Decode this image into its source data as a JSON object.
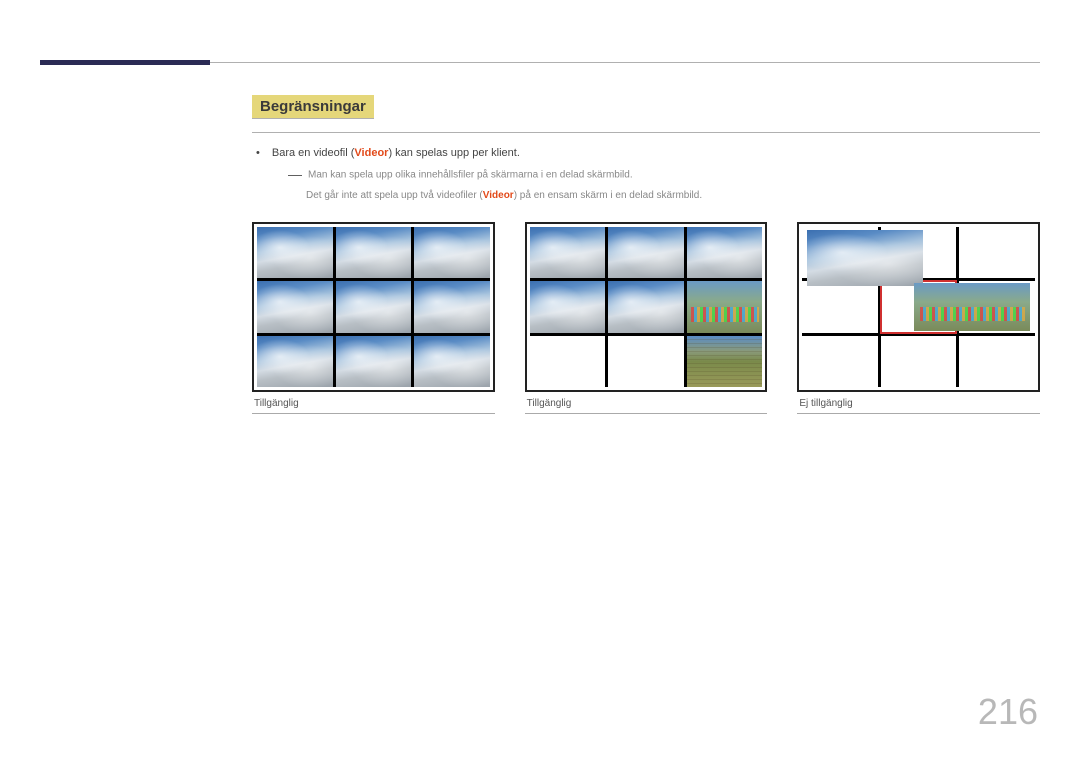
{
  "section_title": "Begränsningar",
  "bullet": {
    "pre": "Bara en videofil (",
    "hl": "Videor",
    "post": ") kan spelas upp per klient."
  },
  "note_line1": "Man kan spela upp olika innehållsfiler på skärmarna i en delad skärmbild.",
  "note_line2": {
    "pre": "Det går inte att spela upp två videofiler (",
    "hl": "Videor",
    "post": ") på en ensam skärm i en delad skärmbild."
  },
  "captions": [
    "Tillgänglig",
    "Tillgänglig",
    "Ej tillgänglig"
  ],
  "page_number": "216"
}
